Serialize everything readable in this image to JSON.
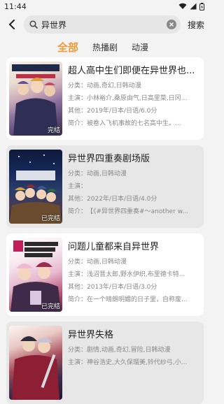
{
  "status": {
    "time": "11:44"
  },
  "search": {
    "query": "异世界",
    "button": "搜索"
  },
  "tabs": [
    {
      "label": "全部",
      "active": true
    },
    {
      "label": "热播剧",
      "active": false
    },
    {
      "label": "动漫",
      "active": false
    }
  ],
  "labels": {
    "genre": "分类：",
    "cast": "主演：",
    "other": "其他：",
    "summary": "简介："
  },
  "results": [
    {
      "title": "超人高中生们即便在异世界也...",
      "genre": "动画,奇幻,日韩动漫",
      "cast": "小林裕介,桑原由气,日高里菜,日冈...",
      "other": "2019年/日本/日语/6.0分",
      "summary": "被卷入飞机事故的七名高中生。...",
      "poster_tag": "完结"
    },
    {
      "title": "异世界四重奏剧场版",
      "genre": "动画,日韩动漫",
      "cast": "",
      "other": "2022年/日本/日语/4.0分",
      "summary": "【《#异世界四重奏#〜another w...",
      "poster_tag": "已完结"
    },
    {
      "title": "问题儿童都来自异世界",
      "genre": "动画,日韩动漫",
      "cast": "浅沼晋太郎,野水伊织,布里德卡特...",
      "other": "2013年/日本/日语/3.0分",
      "summary": "在一个晴朗明媚的日子里，自称废...",
      "poster_tag": "已完结"
    },
    {
      "title": "异世界失格",
      "genre": "剧情,动画,奇幻,冒险,日韩动漫",
      "cast": "神谷浩史,大久保瑠美,铃代纱弓,小...",
      "other": "",
      "summary": "",
      "poster_tag": ""
    }
  ]
}
